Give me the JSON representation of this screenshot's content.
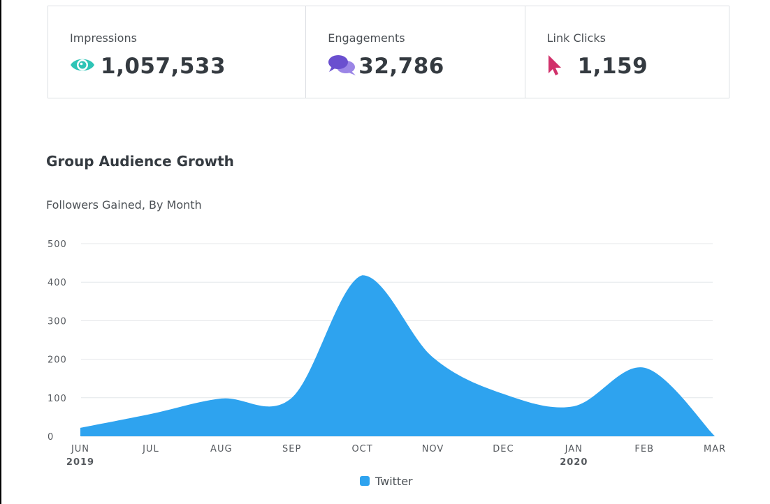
{
  "stats": {
    "impressions": {
      "label": "Impressions",
      "value": "1,057,533",
      "icon": "eye-icon",
      "color": "#2ec4b6"
    },
    "engagements": {
      "label": "Engagements",
      "value": "32,786",
      "icon": "speech-bubbles-icon",
      "color": "#7b5dd6"
    },
    "link_clicks": {
      "label": "Link Clicks",
      "value": "1,159",
      "icon": "cursor-icon",
      "color": "#d1316b"
    }
  },
  "chart_data": {
    "type": "area",
    "title": "Group Audience Growth",
    "subtitle": "Followers Gained, By Month",
    "x": [
      "JUN",
      "JUL",
      "AUG",
      "SEP",
      "OCT",
      "NOV",
      "DEC",
      "JAN",
      "FEB",
      "MAR"
    ],
    "x_years": [
      "2019",
      "",
      "",
      "",
      "",
      "",
      "",
      "2020",
      "",
      ""
    ],
    "yticks": [
      "0",
      "100",
      "200",
      "300",
      "400",
      "500"
    ],
    "ylim": [
      0,
      500
    ],
    "grid": true,
    "legend_position": "bottom-center",
    "series": [
      {
        "name": "Twitter",
        "color": "#2ea3ef",
        "values": [
          22,
          58,
          98,
          100,
          418,
          205,
          110,
          78,
          178,
          0
        ]
      }
    ]
  }
}
